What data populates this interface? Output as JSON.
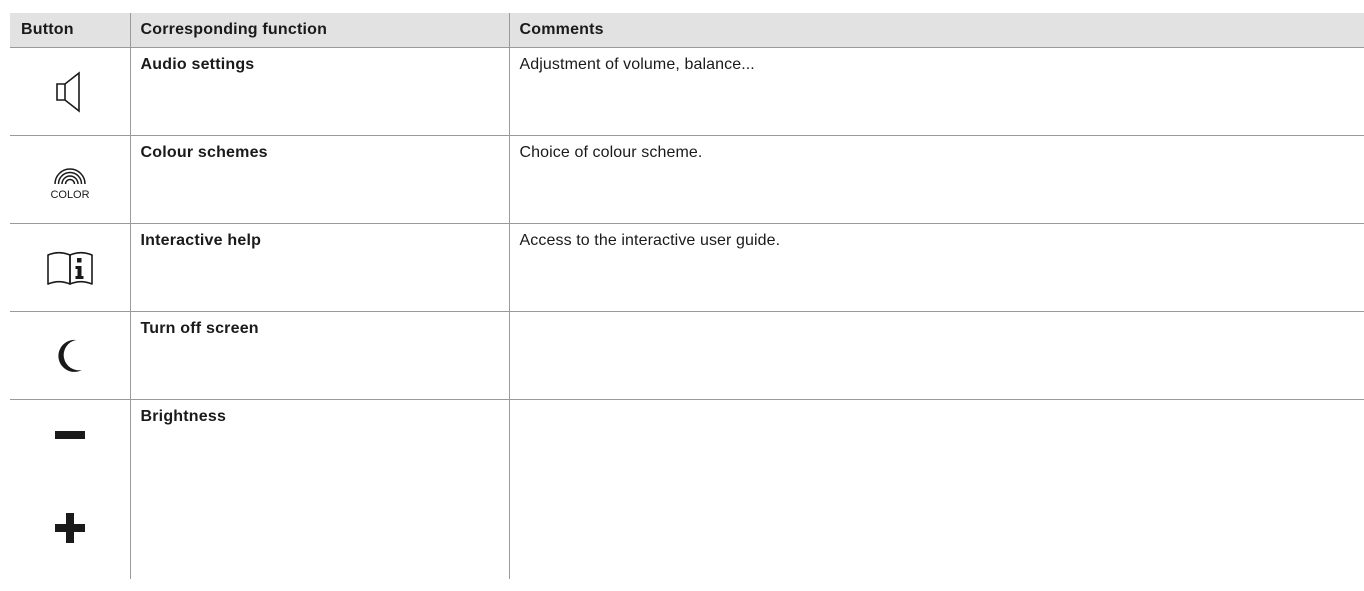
{
  "table": {
    "headers": {
      "button": "Button",
      "function": "Corresponding function",
      "comments": "Comments"
    },
    "rows": [
      {
        "icon": "speaker-icon",
        "function": "Audio settings",
        "comment": "Adjustment of volume, balance..."
      },
      {
        "icon": "color-rainbow-icon",
        "icon_text": "COLOR",
        "function": "Colour schemes",
        "comment": "Choice of colour scheme."
      },
      {
        "icon": "interactive-help-book-icon",
        "function": "Interactive help",
        "comment": "Access to the interactive user guide."
      },
      {
        "icon": "moon-icon",
        "function": "Turn off screen",
        "comment": ""
      },
      {
        "icons": [
          "minus-icon",
          "plus-icon"
        ],
        "function": "Brightness",
        "comment": ""
      }
    ]
  },
  "colors": {
    "header_background": "#e2e2e2",
    "grid_line": "#9a9a9a",
    "text": "#1a1a1a"
  }
}
